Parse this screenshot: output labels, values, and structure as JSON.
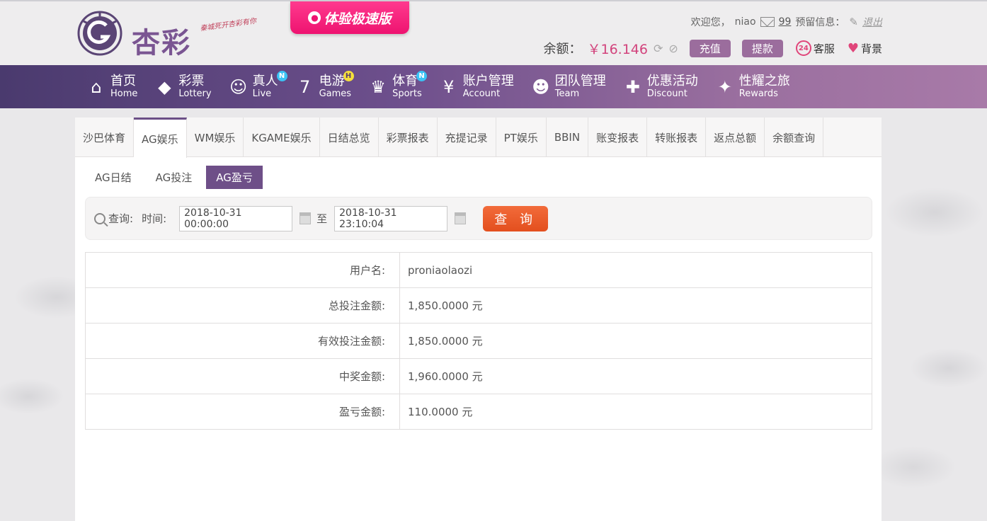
{
  "header": {
    "logo_text": "杏彩",
    "logo_slogan": "秦城死开杏彩有你",
    "promo_label": "体验极速版",
    "welcome": "欢迎您，",
    "username": "niao",
    "mail_count": "99",
    "reserve_info": "预留信息：",
    "logout": "退出",
    "balance_label": "余额：",
    "balance_value": "￥16.146",
    "recharge": "充值",
    "withdraw": "提款",
    "service": "客服",
    "service_icon_text": "24",
    "background": "背景"
  },
  "nav": [
    {
      "cn": "首页",
      "en": "Home",
      "icon": "home-icon",
      "glyph": "⌂",
      "badge": ""
    },
    {
      "cn": "彩票",
      "en": "Lottery",
      "icon": "ticket-icon",
      "glyph": "◆",
      "badge": ""
    },
    {
      "cn": "真人",
      "en": "Live",
      "icon": "dealer-icon",
      "glyph": "☺",
      "badge": "N"
    },
    {
      "cn": "电游",
      "en": "Games",
      "icon": "slot-icon",
      "glyph": "7",
      "badge": "H"
    },
    {
      "cn": "体育",
      "en": "Sports",
      "icon": "trophy-icon",
      "glyph": "♛",
      "badge": "N"
    },
    {
      "cn": "账户管理",
      "en": "Account",
      "icon": "yen-coin-icon",
      "glyph": "¥",
      "badge": ""
    },
    {
      "cn": "团队管理",
      "en": "Team",
      "icon": "team-icon",
      "glyph": "☻",
      "badge": ""
    },
    {
      "cn": "优惠活动",
      "en": "Discount",
      "icon": "gift-icon",
      "glyph": "✚",
      "badge": ""
    },
    {
      "cn": "性耀之旅",
      "en": "Rewards",
      "icon": "rewards-icon",
      "glyph": "✦",
      "badge": ""
    }
  ],
  "tabs": [
    "沙巴体育",
    "AG娱乐",
    "WM娱乐",
    "KGAME娱乐",
    "日结总览",
    "彩票报表",
    "充提记录",
    "PT娱乐",
    "BBIN",
    "账变报表",
    "转账报表",
    "返点总额",
    "余额查询"
  ],
  "active_tab": "AG娱乐",
  "subtabs": [
    "AG日结",
    "AG投注",
    "AG盈亏"
  ],
  "active_subtab": "AG盈亏",
  "search": {
    "query_label": "查询:",
    "time_label": "时间:",
    "start": "2018-10-31 00:00:00",
    "to": "至",
    "end": "2018-10-31 23:10:04",
    "button": "查 询"
  },
  "results": [
    {
      "label": "用户名:",
      "value": "proniaolaozi"
    },
    {
      "label": "总投注金额:",
      "value": "1,850.0000 元"
    },
    {
      "label": "有效投注金额:",
      "value": "1,850.0000 元"
    },
    {
      "label": "中奖金额:",
      "value": "1,960.0000 元"
    },
    {
      "label": "盈亏金额:",
      "value": "110.0000 元"
    }
  ]
}
